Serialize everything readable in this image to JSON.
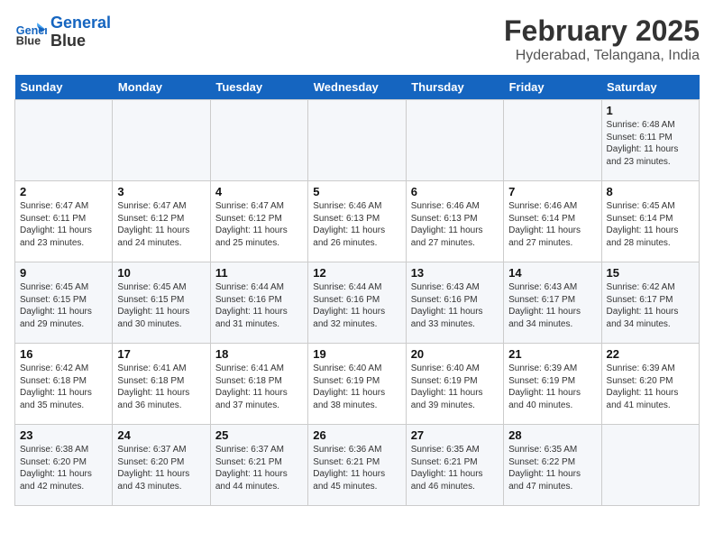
{
  "header": {
    "logo_line1": "General",
    "logo_line2": "Blue",
    "title": "February 2025",
    "subtitle": "Hyderabad, Telangana, India"
  },
  "days_of_week": [
    "Sunday",
    "Monday",
    "Tuesday",
    "Wednesday",
    "Thursday",
    "Friday",
    "Saturday"
  ],
  "weeks": [
    [
      {
        "day": "",
        "info": ""
      },
      {
        "day": "",
        "info": ""
      },
      {
        "day": "",
        "info": ""
      },
      {
        "day": "",
        "info": ""
      },
      {
        "day": "",
        "info": ""
      },
      {
        "day": "",
        "info": ""
      },
      {
        "day": "1",
        "info": "Sunrise: 6:48 AM\nSunset: 6:11 PM\nDaylight: 11 hours\nand 23 minutes."
      }
    ],
    [
      {
        "day": "2",
        "info": "Sunrise: 6:47 AM\nSunset: 6:11 PM\nDaylight: 11 hours\nand 23 minutes."
      },
      {
        "day": "3",
        "info": "Sunrise: 6:47 AM\nSunset: 6:12 PM\nDaylight: 11 hours\nand 24 minutes."
      },
      {
        "day": "4",
        "info": "Sunrise: 6:47 AM\nSunset: 6:12 PM\nDaylight: 11 hours\nand 25 minutes."
      },
      {
        "day": "5",
        "info": "Sunrise: 6:46 AM\nSunset: 6:13 PM\nDaylight: 11 hours\nand 26 minutes."
      },
      {
        "day": "6",
        "info": "Sunrise: 6:46 AM\nSunset: 6:13 PM\nDaylight: 11 hours\nand 27 minutes."
      },
      {
        "day": "7",
        "info": "Sunrise: 6:46 AM\nSunset: 6:14 PM\nDaylight: 11 hours\nand 27 minutes."
      },
      {
        "day": "8",
        "info": "Sunrise: 6:45 AM\nSunset: 6:14 PM\nDaylight: 11 hours\nand 28 minutes."
      }
    ],
    [
      {
        "day": "9",
        "info": "Sunrise: 6:45 AM\nSunset: 6:15 PM\nDaylight: 11 hours\nand 29 minutes."
      },
      {
        "day": "10",
        "info": "Sunrise: 6:45 AM\nSunset: 6:15 PM\nDaylight: 11 hours\nand 30 minutes."
      },
      {
        "day": "11",
        "info": "Sunrise: 6:44 AM\nSunset: 6:16 PM\nDaylight: 11 hours\nand 31 minutes."
      },
      {
        "day": "12",
        "info": "Sunrise: 6:44 AM\nSunset: 6:16 PM\nDaylight: 11 hours\nand 32 minutes."
      },
      {
        "day": "13",
        "info": "Sunrise: 6:43 AM\nSunset: 6:16 PM\nDaylight: 11 hours\nand 33 minutes."
      },
      {
        "day": "14",
        "info": "Sunrise: 6:43 AM\nSunset: 6:17 PM\nDaylight: 11 hours\nand 34 minutes."
      },
      {
        "day": "15",
        "info": "Sunrise: 6:42 AM\nSunset: 6:17 PM\nDaylight: 11 hours\nand 34 minutes."
      }
    ],
    [
      {
        "day": "16",
        "info": "Sunrise: 6:42 AM\nSunset: 6:18 PM\nDaylight: 11 hours\nand 35 minutes."
      },
      {
        "day": "17",
        "info": "Sunrise: 6:41 AM\nSunset: 6:18 PM\nDaylight: 11 hours\nand 36 minutes."
      },
      {
        "day": "18",
        "info": "Sunrise: 6:41 AM\nSunset: 6:18 PM\nDaylight: 11 hours\nand 37 minutes."
      },
      {
        "day": "19",
        "info": "Sunrise: 6:40 AM\nSunset: 6:19 PM\nDaylight: 11 hours\nand 38 minutes."
      },
      {
        "day": "20",
        "info": "Sunrise: 6:40 AM\nSunset: 6:19 PM\nDaylight: 11 hours\nand 39 minutes."
      },
      {
        "day": "21",
        "info": "Sunrise: 6:39 AM\nSunset: 6:19 PM\nDaylight: 11 hours\nand 40 minutes."
      },
      {
        "day": "22",
        "info": "Sunrise: 6:39 AM\nSunset: 6:20 PM\nDaylight: 11 hours\nand 41 minutes."
      }
    ],
    [
      {
        "day": "23",
        "info": "Sunrise: 6:38 AM\nSunset: 6:20 PM\nDaylight: 11 hours\nand 42 minutes."
      },
      {
        "day": "24",
        "info": "Sunrise: 6:37 AM\nSunset: 6:20 PM\nDaylight: 11 hours\nand 43 minutes."
      },
      {
        "day": "25",
        "info": "Sunrise: 6:37 AM\nSunset: 6:21 PM\nDaylight: 11 hours\nand 44 minutes."
      },
      {
        "day": "26",
        "info": "Sunrise: 6:36 AM\nSunset: 6:21 PM\nDaylight: 11 hours\nand 45 minutes."
      },
      {
        "day": "27",
        "info": "Sunrise: 6:35 AM\nSunset: 6:21 PM\nDaylight: 11 hours\nand 46 minutes."
      },
      {
        "day": "28",
        "info": "Sunrise: 6:35 AM\nSunset: 6:22 PM\nDaylight: 11 hours\nand 47 minutes."
      },
      {
        "day": "",
        "info": ""
      }
    ]
  ]
}
